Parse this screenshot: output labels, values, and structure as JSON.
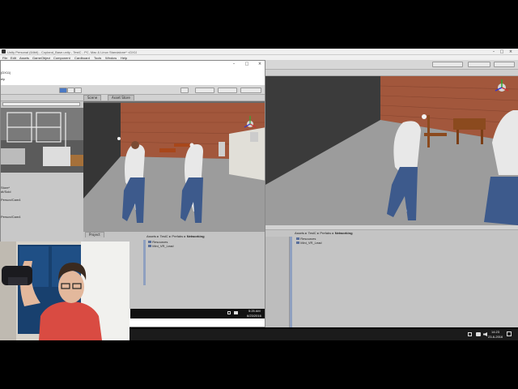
{
  "outer_window": {
    "title": "Unity Personal (64bit) - Copland_Base.unity - TestC - PC, Mac & Linux Standalone* <DX11>",
    "menu": [
      "File",
      "Edit",
      "Assets",
      "GameObject",
      "Component",
      "Cardboard",
      "Tools",
      "Window",
      "Help"
    ]
  },
  "inner_window": {
    "title_fragment": "(DX11)",
    "subtitle_fragment": "elp",
    "tabs": {
      "scene": "Scene",
      "asset_store": "Asset Store",
      "project": "Project"
    },
    "project_breadcrumb": [
      "Assets",
      "TestC",
      "Prefabs",
      "Networking"
    ],
    "project_items": [
      "Resources",
      "Mini_VR_Lead"
    ],
    "hier_items": [
      "Store*",
      "dt/Sold",
      "Person/Cam4",
      "Person/Cam4"
    ],
    "clock": {
      "time": "5:25 AM",
      "date": "6/23/2016"
    }
  },
  "outer_project": {
    "breadcrumb": [
      "Assets",
      "TestC",
      "Prefabs",
      "Networking"
    ],
    "items": [
      "Resources",
      "Mini_VR_Lead"
    ]
  },
  "taskbar": {
    "time": "14:23",
    "date": "23-6-2016"
  },
  "colors": {
    "wall": "#a2573c",
    "floor": "#9c9c9c",
    "skybox": "#3b3b3b",
    "shirt": "#e8e8e8",
    "jeans": "#3d5a8c"
  }
}
